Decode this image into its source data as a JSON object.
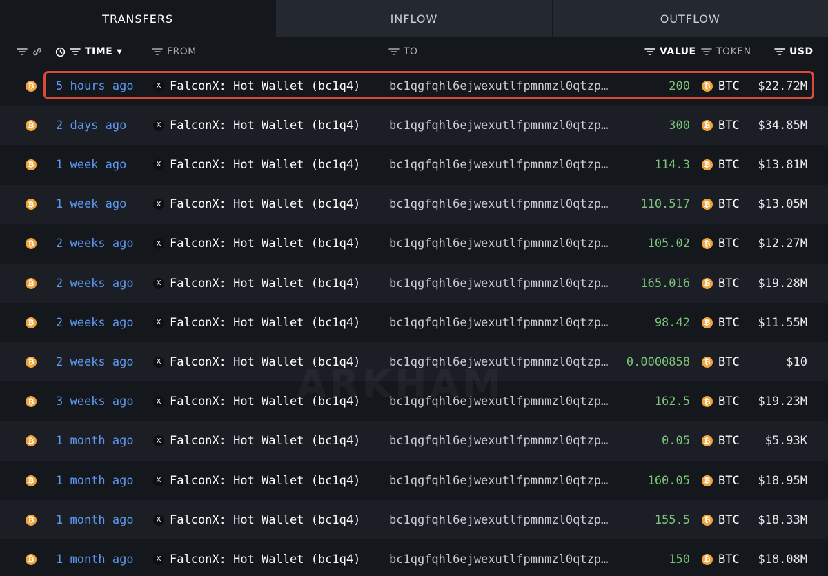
{
  "tabs": [
    {
      "label": "TRANSFERS",
      "active": true
    },
    {
      "label": "INFLOW",
      "active": false
    },
    {
      "label": "OUTFLOW",
      "active": false
    }
  ],
  "columns": {
    "time": "TIME",
    "from": "FROM",
    "to": "TO",
    "value": "VALUE",
    "token": "TOKEN",
    "usd": "USD"
  },
  "watermark": "ARKHAM",
  "colors": {
    "accent_blue": "#5d97f0",
    "value_green": "#7cc47a",
    "btc_orange": "#f2a33a",
    "highlight_red": "#d94a3a"
  },
  "rows": [
    {
      "time": "5 hours ago",
      "from": "FalconX: Hot Wallet (bc1q4)",
      "to": "bc1qgfqhl6ejwexutlfpmnmzl0qtzp…",
      "value": "200",
      "token": "BTC",
      "usd": "$22.72M"
    },
    {
      "time": "2 days ago",
      "from": "FalconX: Hot Wallet (bc1q4)",
      "to": "bc1qgfqhl6ejwexutlfpmnmzl0qtzp…",
      "value": "300",
      "token": "BTC",
      "usd": "$34.85M"
    },
    {
      "time": "1 week ago",
      "from": "FalconX: Hot Wallet (bc1q4)",
      "to": "bc1qgfqhl6ejwexutlfpmnmzl0qtzp…",
      "value": "114.3",
      "token": "BTC",
      "usd": "$13.81M"
    },
    {
      "time": "1 week ago",
      "from": "FalconX: Hot Wallet (bc1q4)",
      "to": "bc1qgfqhl6ejwexutlfpmnmzl0qtzp…",
      "value": "110.517",
      "token": "BTC",
      "usd": "$13.05M"
    },
    {
      "time": "2 weeks ago",
      "from": "FalconX: Hot Wallet (bc1q4)",
      "to": "bc1qgfqhl6ejwexutlfpmnmzl0qtzp…",
      "value": "105.02",
      "token": "BTC",
      "usd": "$12.27M"
    },
    {
      "time": "2 weeks ago",
      "from": "FalconX: Hot Wallet (bc1q4)",
      "to": "bc1qgfqhl6ejwexutlfpmnmzl0qtzp…",
      "value": "165.016",
      "token": "BTC",
      "usd": "$19.28M"
    },
    {
      "time": "2 weeks ago",
      "from": "FalconX: Hot Wallet (bc1q4)",
      "to": "bc1qgfqhl6ejwexutlfpmnmzl0qtzp…",
      "value": "98.42",
      "token": "BTC",
      "usd": "$11.55M"
    },
    {
      "time": "2 weeks ago",
      "from": "FalconX: Hot Wallet (bc1q4)",
      "to": "bc1qgfqhl6ejwexutlfpmnmzl0qtzp…",
      "value": "0.0000858",
      "token": "BTC",
      "usd": "$10"
    },
    {
      "time": "3 weeks ago",
      "from": "FalconX: Hot Wallet (bc1q4)",
      "to": "bc1qgfqhl6ejwexutlfpmnmzl0qtzp…",
      "value": "162.5",
      "token": "BTC",
      "usd": "$19.23M"
    },
    {
      "time": "1 month ago",
      "from": "FalconX: Hot Wallet (bc1q4)",
      "to": "bc1qgfqhl6ejwexutlfpmnmzl0qtzp…",
      "value": "0.05",
      "token": "BTC",
      "usd": "$5.93K"
    },
    {
      "time": "1 month ago",
      "from": "FalconX: Hot Wallet (bc1q4)",
      "to": "bc1qgfqhl6ejwexutlfpmnmzl0qtzp…",
      "value": "160.05",
      "token": "BTC",
      "usd": "$18.95M"
    },
    {
      "time": "1 month ago",
      "from": "FalconX: Hot Wallet (bc1q4)",
      "to": "bc1qgfqhl6ejwexutlfpmnmzl0qtzp…",
      "value": "155.5",
      "token": "BTC",
      "usd": "$18.33M"
    },
    {
      "time": "1 month ago",
      "from": "FalconX: Hot Wallet (bc1q4)",
      "to": "bc1qgfqhl6ejwexutlfpmnmzl0qtzp…",
      "value": "150",
      "token": "BTC",
      "usd": "$18.08M"
    }
  ]
}
